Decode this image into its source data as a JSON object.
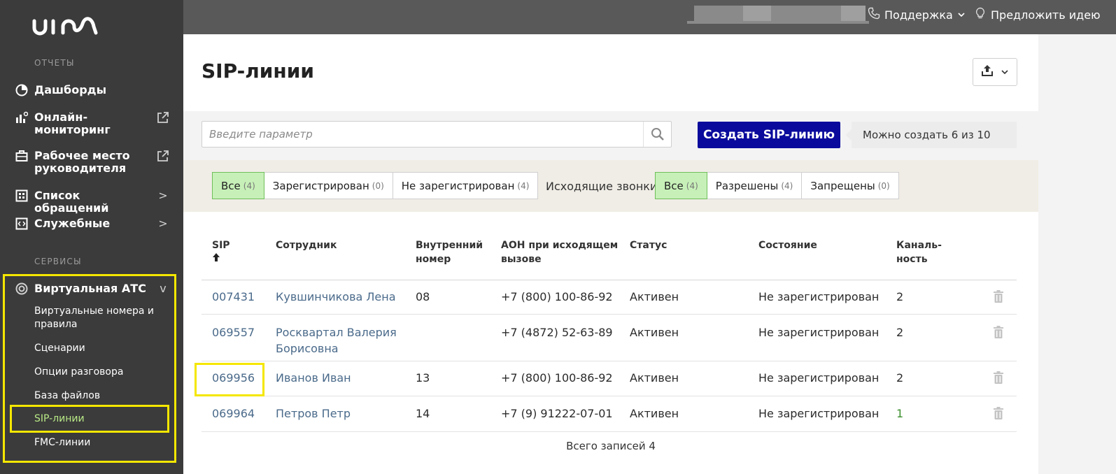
{
  "logo": "uis",
  "sidebar": {
    "reports_label": "ОТЧЕТЫ",
    "services_label": "СЕРВИСЫ",
    "items": [
      {
        "label": "Дашборды"
      },
      {
        "label": "Онлайн-мониторинг"
      },
      {
        "label": "Рабочее место руководителя"
      },
      {
        "label": "Список обращений",
        "arrow": ">"
      },
      {
        "label": "Служебные",
        "arrow": ">"
      }
    ],
    "vats": {
      "label": "Виртуальная АТС",
      "arrow": "v"
    },
    "sub_items": [
      "Виртуальные номера и правила",
      "Сценарии",
      "Опции разговора",
      "База файлов",
      "SIP-линии",
      "FMC-линии"
    ]
  },
  "topbar": {
    "support": "Поддержка",
    "suggest": "Предложить идею"
  },
  "page": {
    "title": "SIP-линии",
    "search_placeholder": "Введите параметр",
    "create_button": "Создать SIP-линию",
    "quota": "Можно создать 6 из 10"
  },
  "filters": {
    "registration": [
      {
        "label": "Все",
        "count": "(4)",
        "selected": true
      },
      {
        "label": "Зарегистрирован",
        "count": "(0)"
      },
      {
        "label": "Не зарегистрирован",
        "count": "(4)"
      }
    ],
    "outgoing_label": "Исходящие звонки",
    "outgoing": [
      {
        "label": "Все",
        "count": "(4)",
        "selected": true
      },
      {
        "label": "Разрешены",
        "count": "(4)"
      },
      {
        "label": "Запрещены",
        "count": "(0)"
      }
    ]
  },
  "table": {
    "columns": {
      "sip": "SIP",
      "employee": "Сотрудник",
      "internal": "Внутренний номер",
      "aon": "АОН при исходящем вызове",
      "status": "Статус",
      "state": "Состояние",
      "channels": "Каналь-ность"
    },
    "rows": [
      {
        "sip": "007431",
        "employee": "Кувшинчикова Лена",
        "internal": "08",
        "aon": "+7 (800) 100-86-92",
        "status": "Активен",
        "state": "Не зарегистрирован",
        "channels": "2"
      },
      {
        "sip": "069557",
        "employee": "Росквартал Валерия Борисовна",
        "internal": "",
        "aon": "+7 (4872) 52-63-89",
        "status": "Активен",
        "state": "Не зарегистрирован",
        "channels": "2"
      },
      {
        "sip": "069956",
        "employee": "Иванов Иван",
        "internal": "13",
        "aon": "+7 (800) 100-86-92",
        "status": "Активен",
        "state": "Не зарегистрирован",
        "channels": "2"
      },
      {
        "sip": "069964",
        "employee": "Петров Петр",
        "internal": "14",
        "aon": "+7 (9) 91222-07-01",
        "status": "Активен",
        "state": "Не зарегистрирован",
        "channels": "1"
      }
    ],
    "total": "Всего записей 4"
  },
  "colors": {
    "sidebar_bg": "#3b3b3b",
    "accent_blue": "#0a0b9c",
    "highlight": "#f5e700",
    "active_sub": "#b8e986"
  }
}
